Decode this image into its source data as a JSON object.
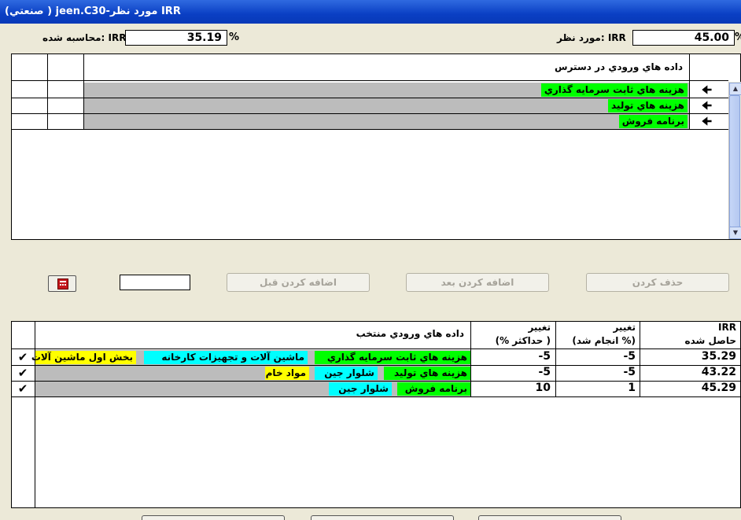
{
  "window": {
    "title": "IRR مورد نظر-jeen.C30 ( صنعتي)"
  },
  "target_irr": {
    "label": "IRR :مورد نظر",
    "value": "45.00",
    "unit": "%"
  },
  "calc_irr": {
    "label": "IRR :محاسبه شده",
    "value": "35.19",
    "unit": "%"
  },
  "available_inputs": {
    "header": "داده هاي ورودي در دسترس",
    "rows": [
      {
        "label": "هزينه هاي ثابت سرمايه گذاري",
        "arrow": "🠈"
      },
      {
        "label": "هزينه هاي توليد",
        "arrow": "🠈"
      },
      {
        "label": "برنامه فروش",
        "arrow": "🠈"
      }
    ]
  },
  "buttons": {
    "delete": "حذف كردن",
    "add_after": "اضافه كردن بعد",
    "add_before": "اضافه كردن قبل",
    "calculator_icon": "calculator-icon"
  },
  "selected": {
    "header_inputs": "داده هاي ورودي منتخب",
    "header_change_max_1": "تغيير",
    "header_change_max_2": "( حداكثر %)",
    "header_change_done_1": "تغيير",
    "header_change_done_2": "(% انجام شد)",
    "header_irr_1": "IRR",
    "header_irr_2": "حاصل شده",
    "rows": [
      {
        "irr": "35.29",
        "done": "-5",
        "max": "-5",
        "tags": [
          "هزينه هاي ثابت سرمايه گذاري",
          "ماشين آلات و تجهيزات كارخانه",
          "بخش اول ماشين آلات"
        ],
        "check": "✔"
      },
      {
        "irr": "43.22",
        "done": "-5",
        "max": "-5",
        "tags": [
          "هزينه هاي توليد",
          "شلوار جين",
          "مواد خام"
        ],
        "check": "✔"
      },
      {
        "irr": "45.29",
        "done": "1",
        "max": "10",
        "tags": [
          "برنامه فروش",
          "شلوار جين"
        ],
        "check": "✔"
      }
    ]
  },
  "colors": {
    "green": "#00ff00",
    "cyan": "#00ffff",
    "yellow": "#ffff00",
    "title_blue": "#0a3fc4"
  }
}
